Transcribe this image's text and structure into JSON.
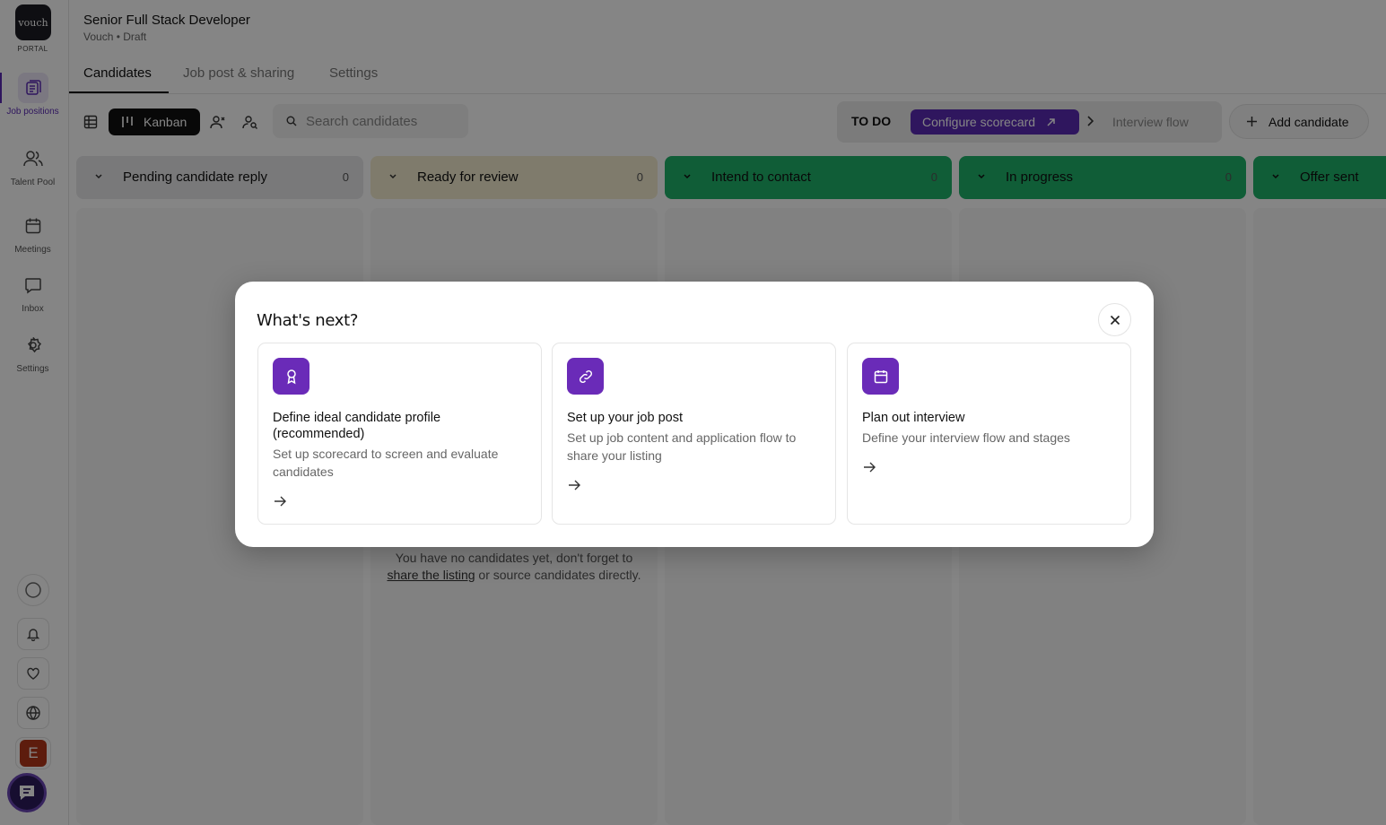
{
  "app": {
    "logo_text": "vouch",
    "logo_sub": "PORTAL"
  },
  "sidebar": {
    "items": [
      {
        "label": "Job positions",
        "icon": "job-positions-icon"
      },
      {
        "label": "Talent Pool",
        "icon": "users-icon"
      },
      {
        "label": "Meetings",
        "icon": "calendar-icon"
      },
      {
        "label": "Inbox",
        "icon": "chat-icon"
      },
      {
        "label": "Settings",
        "icon": "gear-icon"
      }
    ],
    "avatar_initial": "E"
  },
  "header": {
    "title": "Senior Full Stack Developer",
    "subtitle": "Vouch • Draft"
  },
  "tabs": [
    {
      "label": "Candidates",
      "active": true
    },
    {
      "label": "Job post & sharing",
      "active": false
    },
    {
      "label": "Settings",
      "active": false
    }
  ],
  "toolbar": {
    "kanban_label": "Kanban",
    "search_placeholder": "Search candidates",
    "todo_label": "TO DO",
    "configure_label": "Configure scorecard",
    "interview_flow_label": "Interview flow",
    "add_candidate_label": "Add candidate"
  },
  "columns": [
    {
      "name": "Pending candidate reply",
      "count": "0",
      "color": "#e8e8ea"
    },
    {
      "name": "Ready for review",
      "count": "0",
      "color": "#f3ecd0"
    },
    {
      "name": "Intend to contact",
      "count": "0",
      "color": "#1fb26a"
    },
    {
      "name": "In progress",
      "count": "0",
      "color": "#1fb26a"
    },
    {
      "name": "Offer sent",
      "count": "",
      "color": "#1fb26a"
    }
  ],
  "empty_state": {
    "text_before": "You have no candidates yet, don't forget to ",
    "link": "share the listing",
    "text_after": " or source candidates directly."
  },
  "modal": {
    "title": "What's next?",
    "cards": [
      {
        "title": "Define ideal candidate profile (recommended)",
        "desc": "Set up scorecard to screen and evaluate candidates",
        "icon": "award-icon"
      },
      {
        "title": "Set up your job post",
        "desc": "Set up job content and application flow to share your listing",
        "icon": "link-icon"
      },
      {
        "title": "Plan out interview",
        "desc": "Define your interview flow and stages",
        "icon": "calendar-icon"
      }
    ]
  },
  "colors": {
    "accent": "#5b2bb5",
    "card_icon": "#6a2bb8",
    "green": "#1fb26a"
  }
}
